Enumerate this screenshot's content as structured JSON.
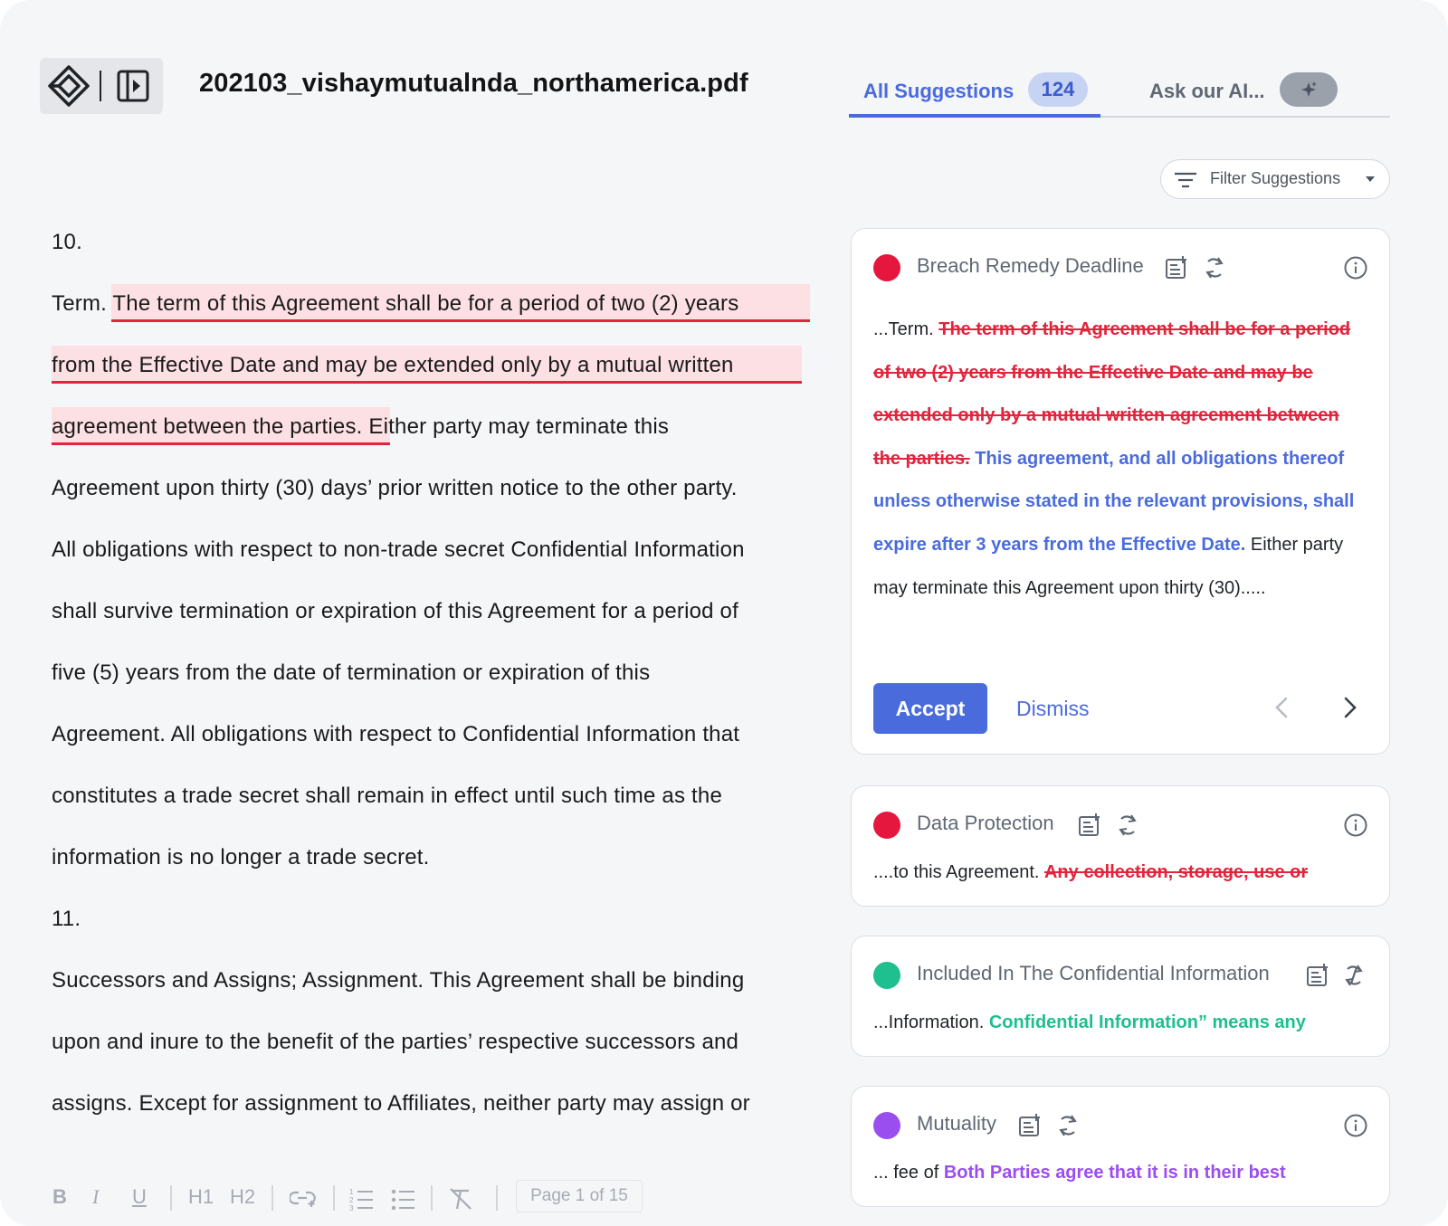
{
  "header": {
    "document_title": "202103_vishaymutualnda_northamerica.pdf"
  },
  "tabs": {
    "all_label": "All Suggestions",
    "all_count": "124",
    "ai_label": "Ask our AI..."
  },
  "filter": {
    "label": "Filter Suggestions"
  },
  "document": {
    "lines": [
      "10.",
      "Term. The term of this Agreement shall be for a period of two (2) years",
      "from the Effective Date and may be extended only by a mutual written",
      "agreement between the parties. Either party may terminate this",
      "Agreement upon thirty (30) days’ prior written notice to the other party.",
      "All obligations with respect to non-trade secret Confidential Information",
      "shall survive termination or expiration of this Agreement for a period of",
      "five (5) years from the date of termination or expiration of this",
      "Agreement. All obligations with respect to Confidential Information that",
      "constitutes a trade secret shall remain in effect until such time as the",
      "information is no longer a trade secret.",
      "11.",
      "Successors and Assigns; Assignment. This Agreement shall be binding",
      "upon and inure to the benefit of the parties’ respective successors and",
      "assigns. Except for assignment to Affiliates, neither party may assign or"
    ]
  },
  "toolbar": {
    "bold": "B",
    "italic": "I",
    "underline": "U",
    "h1": "H1",
    "h2": "H2",
    "page_indicator": "Page 1 of 15"
  },
  "suggestions": [
    {
      "title": "Breach Remedy Deadline",
      "dot_color": "#e5173f",
      "prefix": "...Term. ",
      "deleted": "The term of this Agreement shall be for a period of two (2) years from the Effective Date and may be extended only by a mutual written agreement between the parties.",
      "inserted": "This agreement, and all obligations thereof unless otherwise stated in the relevant provisions, shall expire after 3 years from the Effective Date.",
      "suffix": " Either party may terminate this Agreement upon thirty (30).....",
      "accept_label": "Accept",
      "dismiss_label": "Dismiss"
    },
    {
      "title": "Data Protection",
      "dot_color": "#e5173f",
      "prefix": "....to this Agreement. ",
      "deleted": "Any collection, storage, use or"
    },
    {
      "title": "Included In The Confidential Information",
      "dot_color": "#1fbf8f",
      "prefix": "...Information. ",
      "inserted": "Confidential Information” means any"
    },
    {
      "title": "Mutuality",
      "dot_color": "#9b4ef0",
      "prefix": "... fee of ",
      "inserted": "Both Parties agree that it is in their best"
    }
  ],
  "colors": {
    "accent": "#4a6bdc",
    "deletion": "#e0253d",
    "highlight_bg": "#fde0e3"
  }
}
